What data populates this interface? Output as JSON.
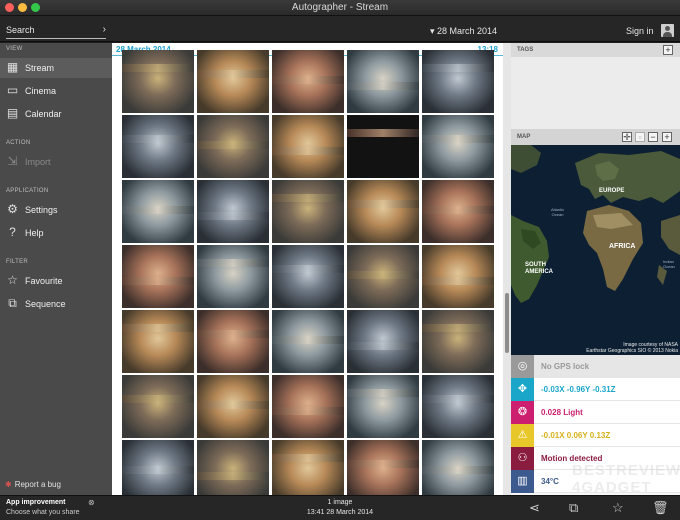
{
  "window": {
    "title": "Autographer - Stream"
  },
  "toolbar": {
    "search_placeholder": "Search",
    "search_arrow": "›",
    "date_label": "▾ 28 March 2014",
    "signin_label": "Sign in"
  },
  "sidebar": {
    "view_header": "VIEW",
    "view_items": [
      {
        "label": "Stream",
        "icon": "grid-icon"
      },
      {
        "label": "Cinema",
        "icon": "film-icon"
      },
      {
        "label": "Calendar",
        "icon": "calendar-icon"
      }
    ],
    "action_header": "ACTION",
    "action_items": [
      {
        "label": "Import",
        "icon": "import-icon"
      }
    ],
    "application_header": "APPLICATION",
    "application_items": [
      {
        "label": "Settings",
        "icon": "gear-icon"
      },
      {
        "label": "Help",
        "icon": "help-icon"
      }
    ],
    "filter_header": "FILTER",
    "filter_items": [
      {
        "label": "Favourite",
        "icon": "star-icon"
      },
      {
        "label": "Sequence",
        "icon": "sequence-icon"
      }
    ],
    "bug_label": "Report a bug"
  },
  "stream": {
    "date": "28 March 2014",
    "time": "13:18",
    "rows": 7,
    "cols": 5
  },
  "panel": {
    "tags_header": "TAGS",
    "map_header": "MAP",
    "map_labels": {
      "europe": "EUROPE",
      "africa": "AFRICA",
      "south_america": "SOUTH\nAMERICA",
      "atlantic": "Atlantic\nOcean",
      "indian": "Indian\nOcean"
    },
    "map_credit": "Image courtesy of NASA\nEarthstar Geographics SIO © 2013 Nokia",
    "sensors": [
      {
        "text": "No GPS lock",
        "icon": "gps-icon",
        "color": "#9a9a9a"
      },
      {
        "text": "-0.03X -0.96Y -0.31Z",
        "icon": "accelerometer-icon",
        "color": "#1aa6c8"
      },
      {
        "text": "0.028 Light",
        "icon": "light-icon",
        "color": "#cc1f6f"
      },
      {
        "text": "-0.01X 0.06Y 0.13Z",
        "icon": "magnetometer-icon",
        "color": "#e8c72a"
      },
      {
        "text": "Motion detected",
        "icon": "motion-icon",
        "color": "#8a1c3f"
      },
      {
        "text": "34°C",
        "icon": "temperature-icon",
        "color": "#3d5a8f"
      }
    ]
  },
  "bottom": {
    "app_improvement": "App improvement",
    "choose_share": "Choose what you share",
    "close_glyph": "⊗",
    "count": "1 image",
    "datetime": "13:41 28 March 2014"
  },
  "watermark": "BESTREVIEW 4GADGET"
}
